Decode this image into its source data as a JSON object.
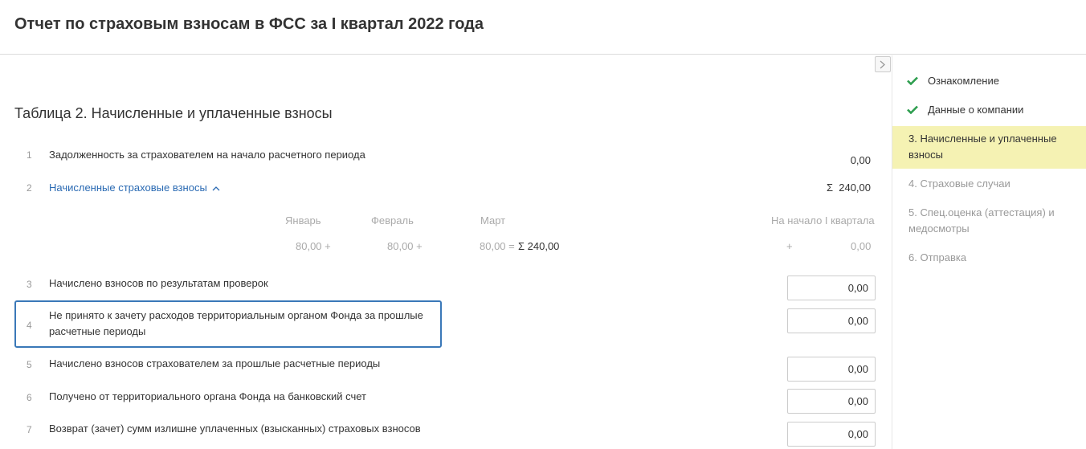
{
  "header": {
    "title": "Отчет по страховым взносам в ФСС за I квартал 2022 года"
  },
  "sidebar": {
    "steps": [
      {
        "label": "Ознакомление",
        "state": "done"
      },
      {
        "label": "Данные о компании",
        "state": "done"
      },
      {
        "label": "3.  Начисленные и уплаченные взносы",
        "state": "active"
      },
      {
        "label": "4.  Страховые случаи",
        "state": "pending"
      },
      {
        "label": "5.  Спец.оценка (аттестация) и медосмотры",
        "state": "pending"
      },
      {
        "label": "6.  Отправка",
        "state": "pending"
      }
    ]
  },
  "section": {
    "title": "Таблица 2. Начисленные и уплаченные взносы"
  },
  "rows": [
    {
      "num": "1",
      "label": "Задолженность за страхователем на начало расчетного периода",
      "value": "0,00"
    },
    {
      "num": "2",
      "label": "Начисленные страховые взносы",
      "sigma": "Σ",
      "value": "240,00"
    },
    {
      "num": "3",
      "label": "Начислено взносов по результатам проверок",
      "value": "0,00"
    },
    {
      "num": "4",
      "label": "Не принято к зачету расходов территориальным органом Фонда за прошлые расчетные периоды",
      "value": "0,00"
    },
    {
      "num": "5",
      "label": "Начислено взносов страхователем за прошлые расчетные периоды",
      "value": "0,00"
    },
    {
      "num": "6",
      "label": "Получено от территориального органа Фонда на банковский счет",
      "value": "0,00"
    },
    {
      "num": "7",
      "label": "Возврат (зачет) сумм излишне уплаченных (взысканных) страховых взносов",
      "value": "0,00"
    }
  ],
  "breakdown": {
    "headers": [
      "Январь",
      "Февраль",
      "Март",
      "На начало I квартала"
    ],
    "values": [
      "80,00 +",
      "80,00 +",
      "80,00 =",
      "Σ  240,00",
      "+",
      "0,00"
    ]
  },
  "colors": {
    "accent": "#2a6ab3",
    "active_step": "#f5f2b3",
    "check": "#2e9e4f",
    "highlight": "#3a78b8"
  }
}
